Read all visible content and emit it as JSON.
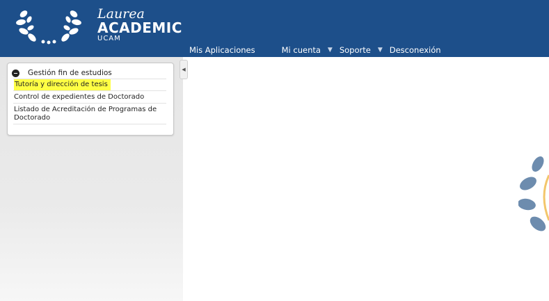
{
  "brand": {
    "script": "Laurea",
    "main": "ACADEMIC",
    "sub": "UCAM"
  },
  "nav": {
    "items": [
      {
        "label": "Mis Aplicaciones",
        "has_caret": false
      },
      {
        "label": "Mi cuenta",
        "has_caret": true
      },
      {
        "label": "Soporte",
        "has_caret": true
      },
      {
        "label": "Desconexión",
        "has_caret": false
      }
    ]
  },
  "sidebar": {
    "panel_title": "Gestión fin de estudios",
    "items": [
      {
        "label": "Tutoría y dirección de tesis",
        "highlighted": true
      },
      {
        "label": "Control de expedientes de Doctorado",
        "highlighted": false
      },
      {
        "label": "Listado de Acreditación de Programas de Doctorado",
        "highlighted": false
      }
    ]
  },
  "colors": {
    "header": "#1d4f8a",
    "highlight": "#ffff44",
    "sidebar_bg": "#e6e6e6"
  },
  "icons": {
    "logo": "laurel-wreath-icon",
    "panel_toggle": "minus-circle-icon",
    "collapse": "chevron-left-icon",
    "nav_caret": "caret-down-icon"
  }
}
